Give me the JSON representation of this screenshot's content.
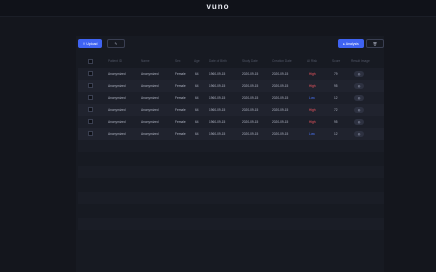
{
  "app": {
    "logo": "vuno"
  },
  "toolbar": {
    "upload_label": "⇧ Upload",
    "edit_icon": "pencil-icon",
    "analysis_label": "▸ Analysis",
    "trash_icon": "trash-icon"
  },
  "table": {
    "headers": [
      "Patient ID",
      "Name",
      "Sex",
      "Age",
      "Date of Birth",
      "Study Date",
      "Creation Date",
      "AI Risk",
      "Score",
      "Result Image"
    ],
    "rows": [
      {
        "patient_id": "Anonymized",
        "name": "Anonymized",
        "sex": "Female",
        "age": "64",
        "dob": "1960-09-15",
        "study_date": "2020-09-15",
        "creation_date": "2020-09-15",
        "risk": "High",
        "score": "79",
        "result": "◍"
      },
      {
        "patient_id": "Anonymized",
        "name": "Anonymized",
        "sex": "Female",
        "age": "64",
        "dob": "1960-09-15",
        "study_date": "2020-09-15",
        "creation_date": "2020-09-15",
        "risk": "High",
        "score": "95",
        "result": "◍"
      },
      {
        "patient_id": "Anonymized",
        "name": "Anonymized",
        "sex": "Female",
        "age": "64",
        "dob": "1960-09-15",
        "study_date": "2020-09-15",
        "creation_date": "2020-09-15",
        "risk": "Low",
        "score": "12",
        "result": "◍"
      },
      {
        "patient_id": "Anonymized",
        "name": "Anonymized",
        "sex": "Female",
        "age": "64",
        "dob": "1960-09-15",
        "study_date": "2020-09-15",
        "creation_date": "2020-09-15",
        "risk": "High",
        "score": "72",
        "result": "◍"
      },
      {
        "patient_id": "Anonymized",
        "name": "Anonymized",
        "sex": "Female",
        "age": "64",
        "dob": "1960-09-15",
        "study_date": "2020-09-15",
        "creation_date": "2020-09-15",
        "risk": "High",
        "score": "95",
        "result": "◍"
      },
      {
        "patient_id": "Anonymized",
        "name": "Anonymized",
        "sex": "Female",
        "age": "64",
        "dob": "1960-09-15",
        "study_date": "2020-09-15",
        "creation_date": "2020-09-15",
        "risk": "Low",
        "score": "12",
        "result": "◍"
      }
    ]
  },
  "colors": {
    "accent": "#3f63f2",
    "high": "#ff5a64",
    "low": "#4c77ff",
    "background": "#14161d"
  }
}
